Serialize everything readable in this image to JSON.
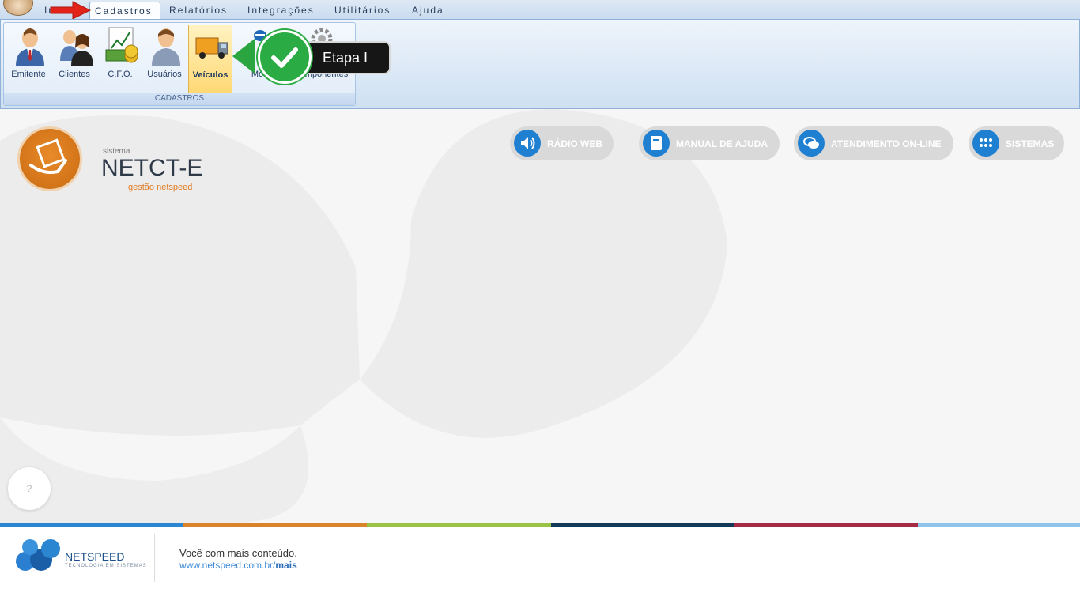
{
  "menu": {
    "items": [
      "Início",
      "Cadastros",
      "Relatórios",
      "Integrações",
      "Utilitários",
      "Ajuda"
    ],
    "active": "Cadastros",
    "visible_first_item_fragment": "Iníc"
  },
  "ribbon": {
    "group_label": "CADASTROS",
    "buttons": [
      {
        "label": "Emitente",
        "icon": "person-tie-icon"
      },
      {
        "label": "Clientes",
        "icon": "people-icon"
      },
      {
        "label": "C.F.O.",
        "icon": "money-chart-icon"
      },
      {
        "label": "Usuários",
        "icon": "user-icon"
      },
      {
        "label": "Veículos",
        "icon": "truck-icon",
        "selected": true
      },
      {
        "label": "Mot",
        "icon": "driver-icon"
      },
      {
        "label": "mponentes",
        "icon": "gear-icon"
      }
    ]
  },
  "callout": {
    "text": "Etapa I",
    "color": "#2bab43"
  },
  "logo": {
    "small": "sistema",
    "title": "NETCT-E",
    "subtitle": "gestão netspeed",
    "accent": "#e07b20"
  },
  "links": [
    {
      "label": "RÁDIO WEB",
      "icon": "speaker-icon"
    },
    {
      "label": "MANUAL DE AJUDA",
      "icon": "book-icon"
    },
    {
      "label": "ATENDIMENTO ON-LINE",
      "icon": "chat-icon"
    },
    {
      "label": "SISTEMAS",
      "icon": "grid-icon"
    }
  ],
  "help": {
    "label": "?"
  },
  "footer": {
    "brand": "NETSPEED",
    "tagline": "TECNOLOGIA EM SISTEMAS",
    "text": "Você com mais conteúdo.",
    "link_prefix": "www.netspeed.com.br/",
    "link_bold": "mais",
    "stripe_colors": [
      "#2a86d0",
      "#d9832b",
      "#9ac244",
      "#123a58",
      "#a52a45",
      "#8fc5ea"
    ]
  }
}
